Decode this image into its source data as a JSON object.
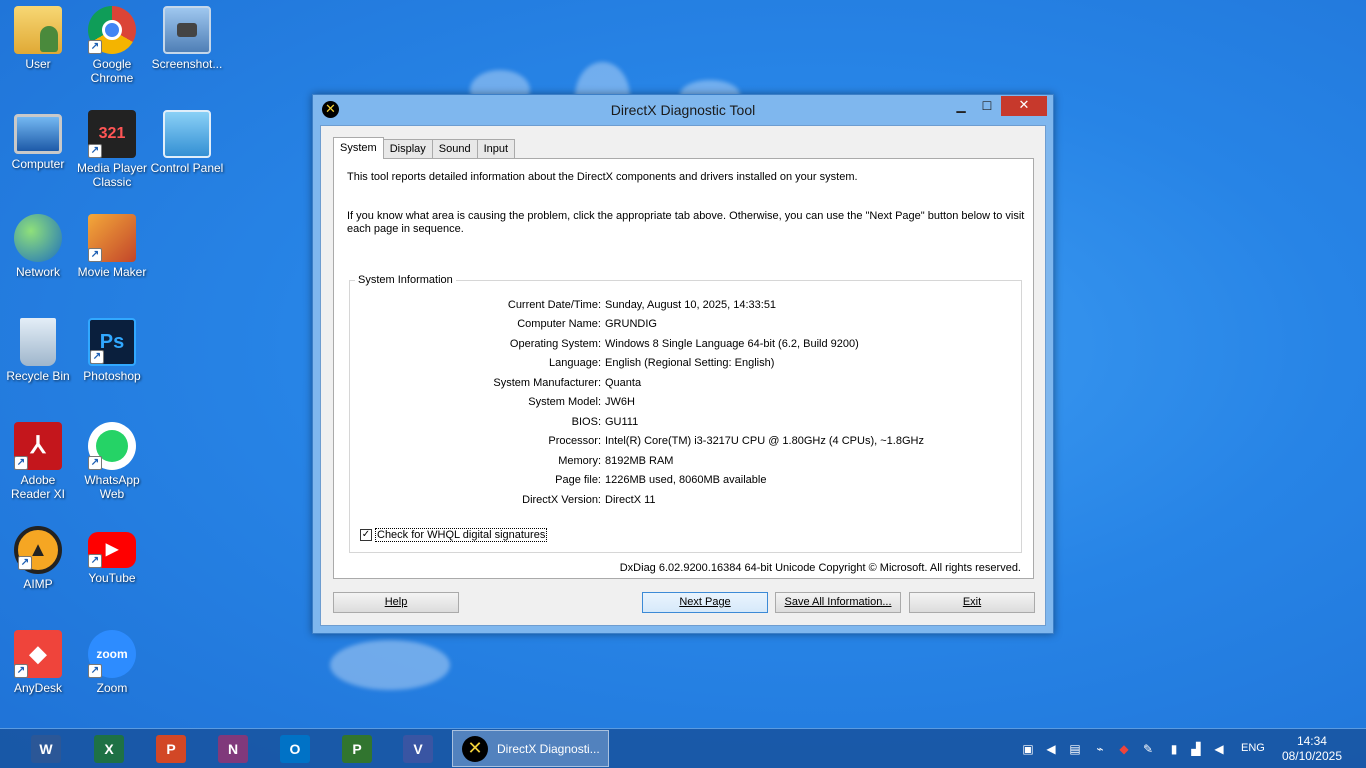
{
  "desktop": {
    "icons": [
      {
        "label": "User"
      },
      {
        "label": "Google Chrome"
      },
      {
        "label": "Screenshot..."
      },
      {
        "label": "Computer"
      },
      {
        "label": "Media Player Classic"
      },
      {
        "label": "Control Panel"
      },
      {
        "label": "Network"
      },
      {
        "label": "Movie Maker"
      },
      {
        "label": "Recycle Bin"
      },
      {
        "label": "Photoshop"
      },
      {
        "label": "Adobe Reader XI"
      },
      {
        "label": "WhatsApp Web"
      },
      {
        "label": "AIMP"
      },
      {
        "label": "YouTube"
      },
      {
        "label": "AnyDesk"
      },
      {
        "label": "Zoom"
      }
    ]
  },
  "window": {
    "title": "DirectX Diagnostic Tool",
    "minimize": "▁",
    "maximize": "☐",
    "close": "✕",
    "tabs": [
      {
        "label": "System"
      },
      {
        "label": "Display"
      },
      {
        "label": "Sound"
      },
      {
        "label": "Input"
      }
    ],
    "intro1": "This tool reports detailed information about the DirectX components and drivers installed on your system.",
    "intro2": "If you know what area is causing the problem, click the appropriate tab above.  Otherwise, you can use the \"Next Page\" button below to visit each page in sequence.",
    "group_title": "System Information",
    "rows": [
      {
        "label": "Current Date/Time:",
        "value": "Sunday, August 10, 2025, 14:33:51"
      },
      {
        "label": "Computer Name:",
        "value": "GRUNDIG"
      },
      {
        "label": "Operating System:",
        "value": "Windows 8 Single Language 64-bit (6.2, Build 9200)"
      },
      {
        "label": "Language:",
        "value": "English (Regional Setting: English)"
      },
      {
        "label": "System Manufacturer:",
        "value": "Quanta"
      },
      {
        "label": "System Model:",
        "value": "JW6H"
      },
      {
        "label": "BIOS:",
        "value": "GU111"
      },
      {
        "label": "Processor:",
        "value": "Intel(R) Core(TM) i3-3217U CPU @ 1.80GHz (4 CPUs), ~1.8GHz"
      },
      {
        "label": "Memory:",
        "value": "8192MB RAM"
      },
      {
        "label": "Page file:",
        "value": "1226MB used, 8060MB available"
      },
      {
        "label": "DirectX Version:",
        "value": "DirectX 11"
      }
    ],
    "whql_label": "Check for WHQL digital signatures",
    "whql_checked": "✓",
    "copyright": "DxDiag 6.02.9200.16384 64-bit Unicode  Copyright © Microsoft. All rights reserved.",
    "buttons": {
      "help": "Help",
      "next": "Next Page",
      "save": "Save All Information...",
      "exit": "Exit"
    }
  },
  "taskbar": {
    "pinned": [
      {
        "name": "word",
        "glyph": "W",
        "color": "#2b5797"
      },
      {
        "name": "excel",
        "glyph": "X",
        "color": "#1e7145"
      },
      {
        "name": "powerpoint",
        "glyph": "P",
        "color": "#d24726"
      },
      {
        "name": "onenote",
        "glyph": "N",
        "color": "#80397b"
      },
      {
        "name": "outlook",
        "glyph": "O",
        "color": "#0072c6"
      },
      {
        "name": "project",
        "glyph": "P",
        "color": "#31752f"
      },
      {
        "name": "visio",
        "glyph": "V",
        "color": "#3955a3"
      }
    ],
    "active_task": "DirectX Diagnosti...",
    "language": "ENG",
    "time": "14:34",
    "date": "08/10/2025"
  }
}
